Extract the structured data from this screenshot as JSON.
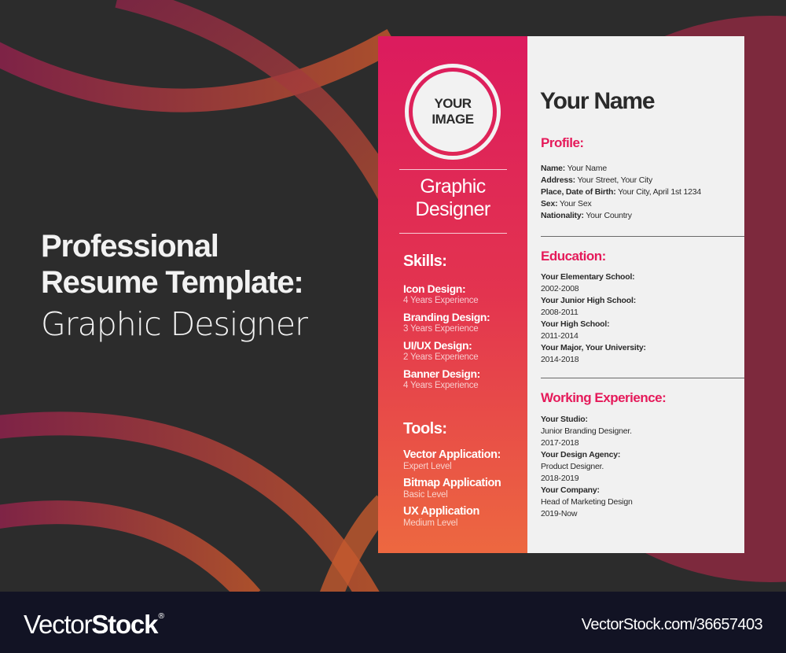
{
  "headline": {
    "line1": "Professional",
    "line2": "Resume Template:",
    "line3": "Graphic Designer"
  },
  "colors": {
    "background": "#2c2c2c",
    "accent_pink": "#dc1b5e",
    "accent_orange": "#ed6840",
    "section_heading": "#e51a5a",
    "footer": "#121324"
  },
  "resume": {
    "photo": {
      "line1": "YOUR",
      "line2": "IMAGE"
    },
    "role": {
      "line1": "Graphic",
      "line2": "Designer"
    },
    "skills": {
      "heading": "Skills:",
      "items": [
        {
          "title": "Icon Design:",
          "detail": "4 Years Experience"
        },
        {
          "title": "Branding Design:",
          "detail": "3 Years Experience"
        },
        {
          "title": "UI/UX Design:",
          "detail": "2 Years Experience"
        },
        {
          "title": "Banner Design:",
          "detail": "4 Years Experience"
        }
      ]
    },
    "tools": {
      "heading": "Tools:",
      "items": [
        {
          "title": "Vector Application:",
          "detail": "Expert Level"
        },
        {
          "title": "Bitmap Application",
          "detail": "Basic Level"
        },
        {
          "title": "UX Application",
          "detail": "Medium Level"
        }
      ]
    },
    "name": "Your Name",
    "profile": {
      "heading": "Profile:",
      "rows": [
        {
          "label": "Name:",
          "value": "Your Name"
        },
        {
          "label": "Address:",
          "value": "Your Street, Your City"
        },
        {
          "label": "Place, Date of Birth:",
          "value": "Your City, April 1st 1234"
        },
        {
          "label": "Sex:",
          "value": "Your Sex"
        },
        {
          "label": "Nationality:",
          "value": "Your Country"
        }
      ]
    },
    "education": {
      "heading": "Education:",
      "items": [
        {
          "school": "Your Elementary School:",
          "years": "2002-2008"
        },
        {
          "school": "Your Junior High School:",
          "years": "2008-2011"
        },
        {
          "school": "Your High School:",
          "years": "2011-2014"
        },
        {
          "school": "Your Major, Your University:",
          "years": "2014-2018"
        }
      ]
    },
    "experience": {
      "heading": "Working Experience:",
      "items": [
        {
          "company": "Your Studio:",
          "role": "Junior Branding Designer.",
          "years": "2017-2018"
        },
        {
          "company": "Your Design Agency:",
          "role": "Product Designer.",
          "years": "2018-2019"
        },
        {
          "company": "Your Company:",
          "role": "Head of Marketing Design",
          "years": "2019-Now"
        }
      ]
    }
  },
  "watermark": "VectorStock",
  "footer": {
    "logo_light": "Vector",
    "logo_bold": "Stock",
    "logo_mark": "®",
    "url": "VectorStock.com/36657403"
  }
}
